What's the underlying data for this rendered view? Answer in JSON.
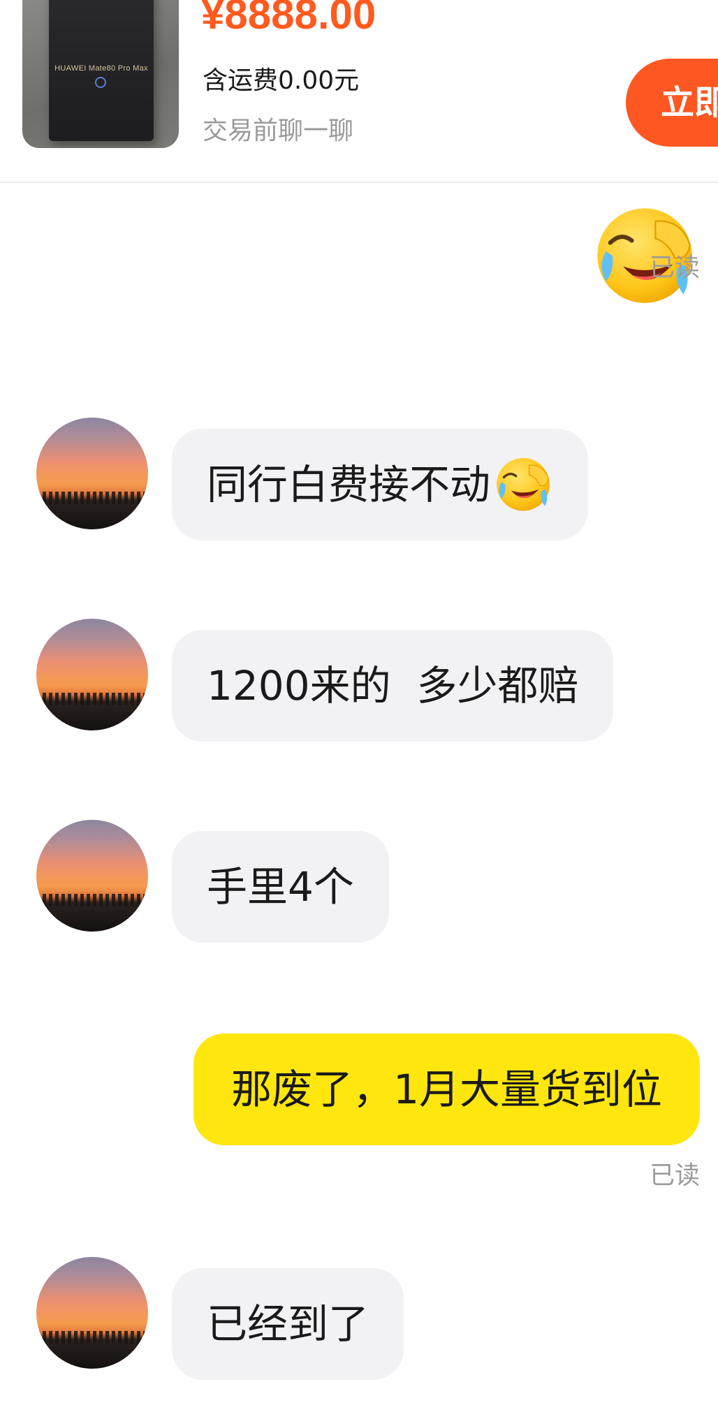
{
  "product": {
    "price": "¥8888.00",
    "shipping": "含运费0.00元",
    "chat_hint": "交易前聊一聊",
    "buy_label": "立即",
    "thumb_brand": "HUAWEI Mate80 Pro Max"
  },
  "messages": [
    {
      "side": "right",
      "type": "emoji",
      "icon": "crying-laughing-emoji-icon",
      "status": "已读"
    },
    {
      "side": "left",
      "text": "同行白费接不动",
      "icon": "crying-laughing-emoji-icon"
    },
    {
      "side": "left",
      "text": "1200来的  多少都赔"
    },
    {
      "side": "left",
      "text": "手里4个"
    },
    {
      "side": "right",
      "text": "那废了，1月大量货到位",
      "status": "已读"
    },
    {
      "side": "left",
      "text": "已经到了"
    }
  ],
  "colors": {
    "price": "#ff5a1f",
    "buy_button": "#ff5722",
    "my_bubble": "#ffe60f",
    "their_bubble": "#f2f2f4",
    "muted_text": "#9a9a9a"
  }
}
